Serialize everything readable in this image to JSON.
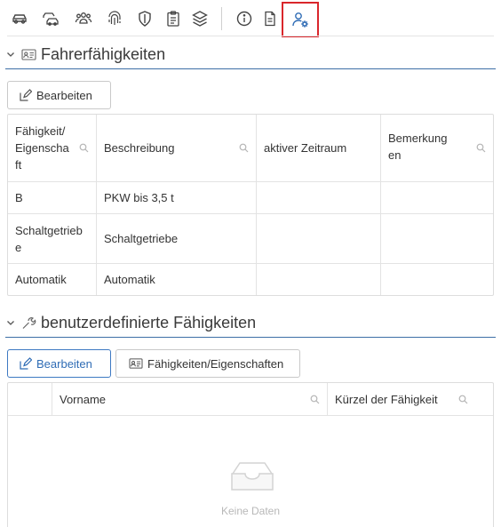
{
  "toolbar": {
    "icons": [
      "car-icon",
      "cars-icon",
      "group-icon",
      "fingerprint-icon",
      "shield-icon",
      "clipboard-icon",
      "layers-icon",
      "info-icon",
      "document-icon",
      "user-settings-icon"
    ],
    "active_icon": "user-settings-icon",
    "highlight_color": "#d9262b",
    "accent_color": "#2f6cb5"
  },
  "section1": {
    "title": "Fahrerfähigkeiten",
    "edit_button": "Bearbeiten",
    "columns": [
      "Fähigkeit/\nEigenscha\nft",
      "Beschreibung",
      "aktiver Zeitraum",
      "Bemerkung\nen"
    ],
    "rows": [
      [
        "B",
        "PKW bis 3,5 t",
        "",
        ""
      ],
      [
        "Schaltgetrieb\ne",
        "Schaltgetriebe",
        "",
        ""
      ],
      [
        "Automatik",
        "Automatik",
        "",
        ""
      ]
    ]
  },
  "section2": {
    "title": "benutzerdefinierte Fähigkeiten",
    "edit_button": "Bearbeiten",
    "skills_button": "Fähigkeiten/Eigenschaften",
    "columns": [
      "",
      "Vorname",
      "Kürzel der Fähigkeit"
    ],
    "empty_text": "Keine Daten"
  }
}
